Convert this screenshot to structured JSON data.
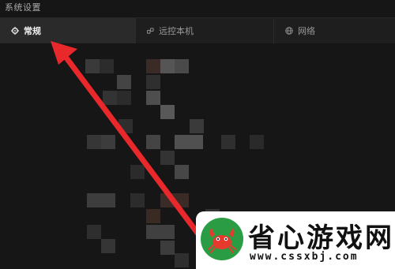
{
  "window": {
    "title": "系统设置"
  },
  "tabs": [
    {
      "label": "常规",
      "icon": "gear-icon",
      "active": true
    },
    {
      "label": "远控本机",
      "icon": "link-icon",
      "active": false
    },
    {
      "label": "网络",
      "icon": "globe-icon",
      "active": false
    }
  ],
  "annotation": {
    "arrow_color": "#e8282b"
  },
  "watermark": {
    "brand": "省心游戏网",
    "url": "www.cssxbj.com",
    "logo": "crab-logo",
    "brand_color": "#2a9d44"
  }
}
